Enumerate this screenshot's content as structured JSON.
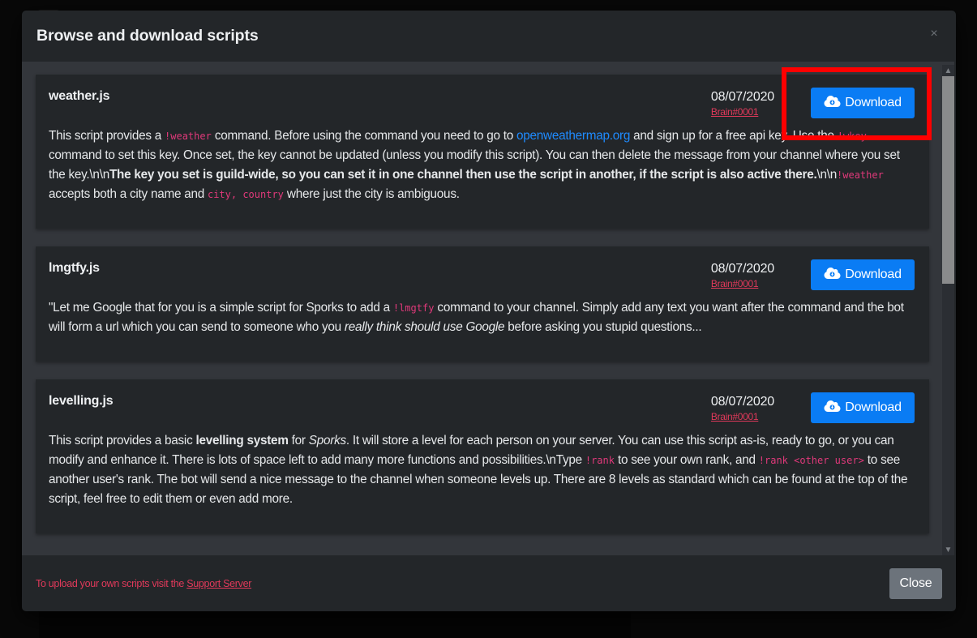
{
  "modal": {
    "title": "Browse and download scripts",
    "close_icon": "close-x-icon"
  },
  "scripts": [
    {
      "name": "weather.js",
      "date": "08/07/2020",
      "author": "Brain#0001",
      "download_label": "Download",
      "download_icon": "cloud-download-icon",
      "description": [
        {
          "t": "text",
          "v": "This script provides a "
        },
        {
          "t": "code",
          "v": "!weather"
        },
        {
          "t": "text",
          "v": " command. Before using the command you need to go to "
        },
        {
          "t": "link",
          "v": "openweathermap.org"
        },
        {
          "t": "text",
          "v": " and sign up for a free api key. Use the "
        },
        {
          "t": "code",
          "v": "!wkey"
        },
        {
          "t": "text",
          "v": " command to set this key. Once set, the key cannot be updated (unless you modify this script). You can then delete the message from your channel where you set the key.\\n\\n"
        },
        {
          "t": "bold",
          "v": "The key you set is guild-wide, so you can set it in one channel then use the script in another, if the script is also active there."
        },
        {
          "t": "text",
          "v": "\\n\\n"
        },
        {
          "t": "code",
          "v": "!weather"
        },
        {
          "t": "text",
          "v": " accepts both a city name and "
        },
        {
          "t": "code",
          "v": "city, country"
        },
        {
          "t": "text",
          "v": " where just the city is ambiguous."
        }
      ]
    },
    {
      "name": "lmgtfy.js",
      "date": "08/07/2020",
      "author": "Brain#0001",
      "download_label": "Download",
      "download_icon": "cloud-download-icon",
      "description": [
        {
          "t": "text",
          "v": "\"Let me Google that for you is a simple script for Sporks to add a "
        },
        {
          "t": "code",
          "v": "!lmgtfy"
        },
        {
          "t": "text",
          "v": " command to your channel. Simply add any text you want after the command and the bot will form a url which you can send to someone who you "
        },
        {
          "t": "italic",
          "v": "really think should use Google"
        },
        {
          "t": "text",
          "v": " before asking you stupid questions..."
        }
      ]
    },
    {
      "name": "levelling.js",
      "date": "08/07/2020",
      "author": "Brain#0001",
      "download_label": "Download",
      "download_icon": "cloud-download-icon",
      "description": [
        {
          "t": "text",
          "v": "This script provides a basic "
        },
        {
          "t": "bold",
          "v": "levelling system"
        },
        {
          "t": "text",
          "v": " for "
        },
        {
          "t": "italic",
          "v": "Sporks"
        },
        {
          "t": "text",
          "v": ". It will store a level for each person on your server. You can use this script as-is, ready to go, or you can modify and enhance it. There is lots of space left to add many more functions and possibilities.\\nType "
        },
        {
          "t": "code",
          "v": "!rank"
        },
        {
          "t": "text",
          "v": " to see your own rank, and "
        },
        {
          "t": "code",
          "v": "!rank <other user>"
        },
        {
          "t": "text",
          "v": " to see another user's rank. The bot will send a nice message to the channel when someone levels up. There are 8 levels as standard which can be found at the top of the script, feel free to edit them or even add more."
        }
      ]
    }
  ],
  "footer": {
    "note_prefix": "To upload your own scripts visit the ",
    "note_link": "Support Server",
    "close_label": "Close"
  },
  "colors": {
    "primary": "#0a7cf4",
    "accent_red": "#e0395a",
    "highlight": "#ff0000"
  }
}
